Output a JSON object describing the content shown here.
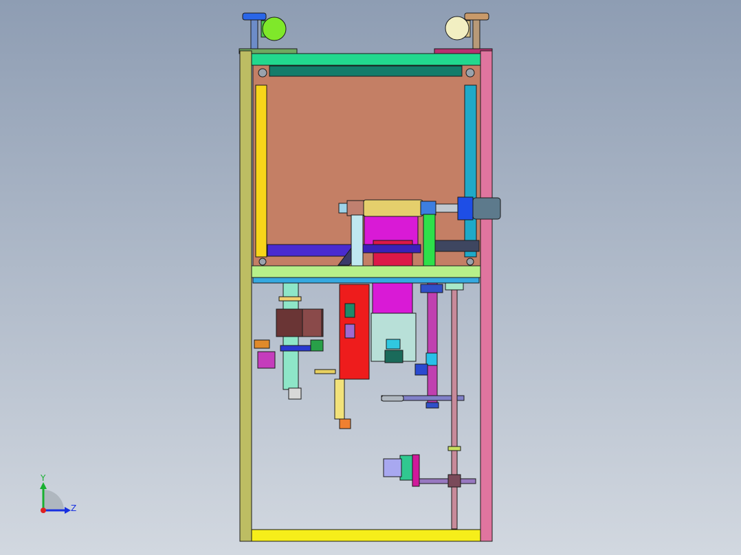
{
  "viewport": {
    "background_top": "#8e9db3",
    "background_bottom": "#d2d8e0"
  },
  "triad": {
    "y_label": "Y",
    "z_label": "Z",
    "y_color": "#18b030",
    "z_color": "#1830e0",
    "origin_color": "#e02020"
  },
  "colors": {
    "frame_left_post": "#bdbd63",
    "frame_right_post": "#e0759f",
    "top_beam": "#22d88e",
    "inner_top_bar": "#137c6a",
    "panel": "#c47f65",
    "left_strip": "#f7d51a",
    "right_strip": "#1fa9c8",
    "shelf": "#b6f08a",
    "shelf_blue": "#35a9e0",
    "bottom_beam": "#f6ee1a",
    "red_block": "#ee1c1c",
    "crimson_block": "#dc1848",
    "magenta_block": "#d91ad6",
    "motor_blue": "#1e4ee6",
    "motor_grey": "#5d7a8c",
    "cylinder_gold": "#e5cf6c",
    "left_knob_cap": "#2a66e8",
    "left_knob_disc": "#7fe82a",
    "right_knob_cap": "#c99a6a",
    "right_knob_disc": "#f2efc2"
  }
}
